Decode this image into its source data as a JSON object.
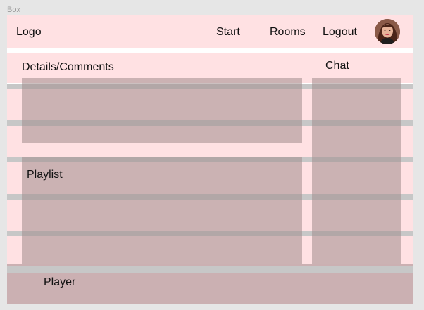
{
  "frame": {
    "label": "Box"
  },
  "header": {
    "logo": "Logo",
    "nav": [
      {
        "label": "Start"
      },
      {
        "label": "Rooms"
      },
      {
        "label": "Logout"
      }
    ],
    "avatar_icon": "user-avatar-photo"
  },
  "regions": {
    "details": "Details/Comments",
    "chat": "Chat",
    "playlist": "Playlist",
    "player": "Player"
  },
  "colors": {
    "grid_row": "#ffe1e3",
    "region_overlay": "#cbb0b2",
    "gutter": "#c7c7c7",
    "background": "#e6e6e6"
  }
}
